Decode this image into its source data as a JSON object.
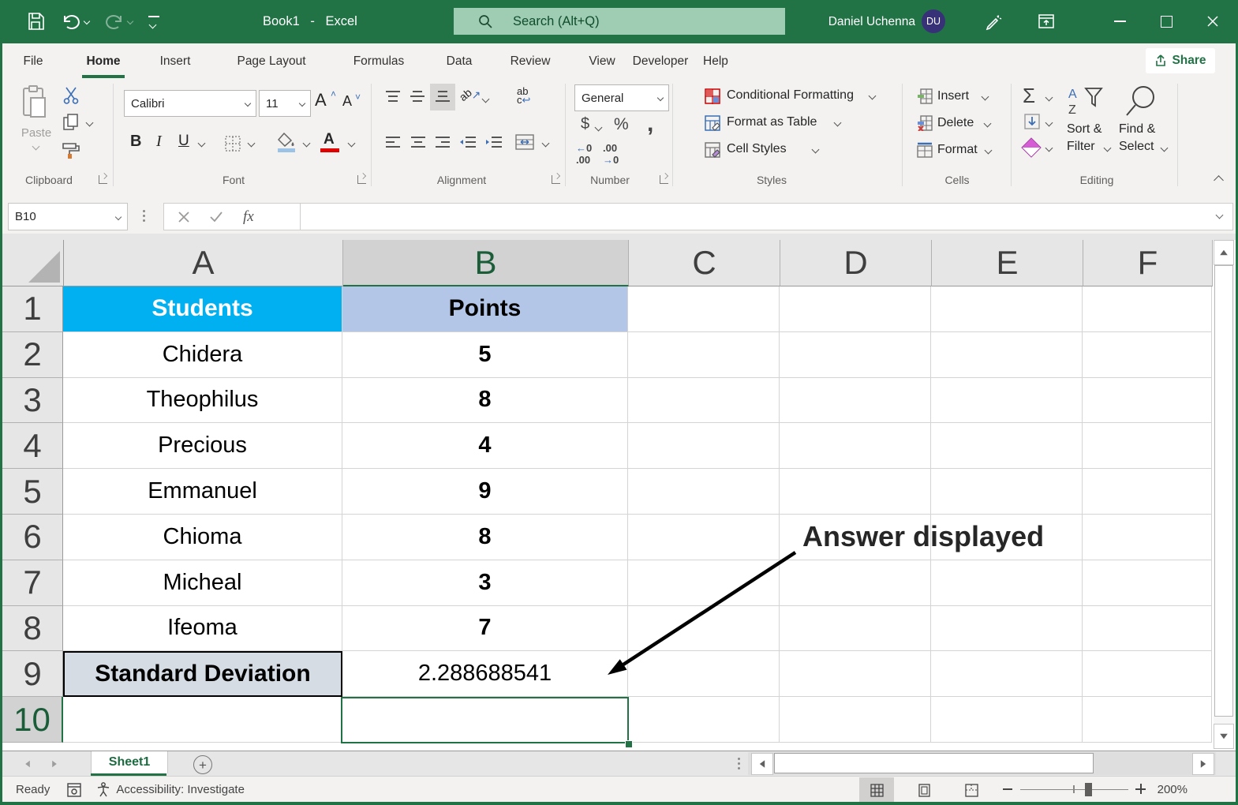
{
  "titlebar": {
    "title": "Book1 - Excel",
    "search_placeholder": "Search (Alt+Q)",
    "user_name": "Daniel Uchenna",
    "user_initials": "DU"
  },
  "menu": {
    "items": [
      "File",
      "Home",
      "Insert",
      "Page Layout",
      "Formulas",
      "Data",
      "Review",
      "View",
      "Developer",
      "Help"
    ],
    "share_label": "Share"
  },
  "ribbon": {
    "clipboard": {
      "label": "Clipboard",
      "paste_label": "Paste"
    },
    "font": {
      "label": "Font",
      "family": "Calibri",
      "size": "11",
      "bold": "B",
      "italic": "I",
      "underline": "U"
    },
    "alignment": {
      "label": "Alignment"
    },
    "number": {
      "label": "Number",
      "format": "General",
      "currency": "$",
      "percent": "%",
      "comma": ","
    },
    "styles": {
      "label": "Styles",
      "conditional": "Conditional Formatting",
      "format_table": "Format as Table",
      "cell_styles": "Cell Styles"
    },
    "cells": {
      "label": "Cells",
      "insert": "Insert",
      "delete": "Delete",
      "format": "Format"
    },
    "editing": {
      "label": "Editing",
      "autosum": "Σ",
      "sort1": "Sort &",
      "sort2": "Filter",
      "find1": "Find &",
      "find2": "Select"
    }
  },
  "formula_bar": {
    "name_box": "B10",
    "fx_label": "fx"
  },
  "sheet": {
    "col_headers": [
      "A",
      "B",
      "C",
      "D",
      "E",
      "F"
    ],
    "selected_cell": "B10",
    "rows": [
      {
        "n": "1",
        "a": "Students",
        "b": "Points"
      },
      {
        "n": "2",
        "a": "Chidera",
        "b": "5"
      },
      {
        "n": "3",
        "a": "Theophilus",
        "b": "8"
      },
      {
        "n": "4",
        "a": "Precious",
        "b": "4"
      },
      {
        "n": "5",
        "a": "Emmanuel",
        "b": "9"
      },
      {
        "n": "6",
        "a": "Chioma",
        "b": "8"
      },
      {
        "n": "7",
        "a": "Micheal",
        "b": "3"
      },
      {
        "n": "8",
        "a": "Ifeoma",
        "b": "7"
      },
      {
        "n": "9",
        "a": "Standard Deviation",
        "b": "2.288688541"
      },
      {
        "n": "10",
        "a": "",
        "b": ""
      }
    ]
  },
  "annotation": {
    "text": "Answer displayed"
  },
  "tabs": {
    "sheet1": "Sheet1"
  },
  "status": {
    "ready": "Ready",
    "accessibility": "Accessibility: Investigate",
    "zoom_level": "200%"
  },
  "colors": {
    "excel_green": "#217346",
    "header_select": "#d2d2d2",
    "cell_blue": "#00b0f0",
    "cell_periwinkle": "#b4c6e7",
    "cell_gray_blue": "#d6dce4",
    "search_bg": "#9fcdb3",
    "avatar_bg": "#373277"
  }
}
